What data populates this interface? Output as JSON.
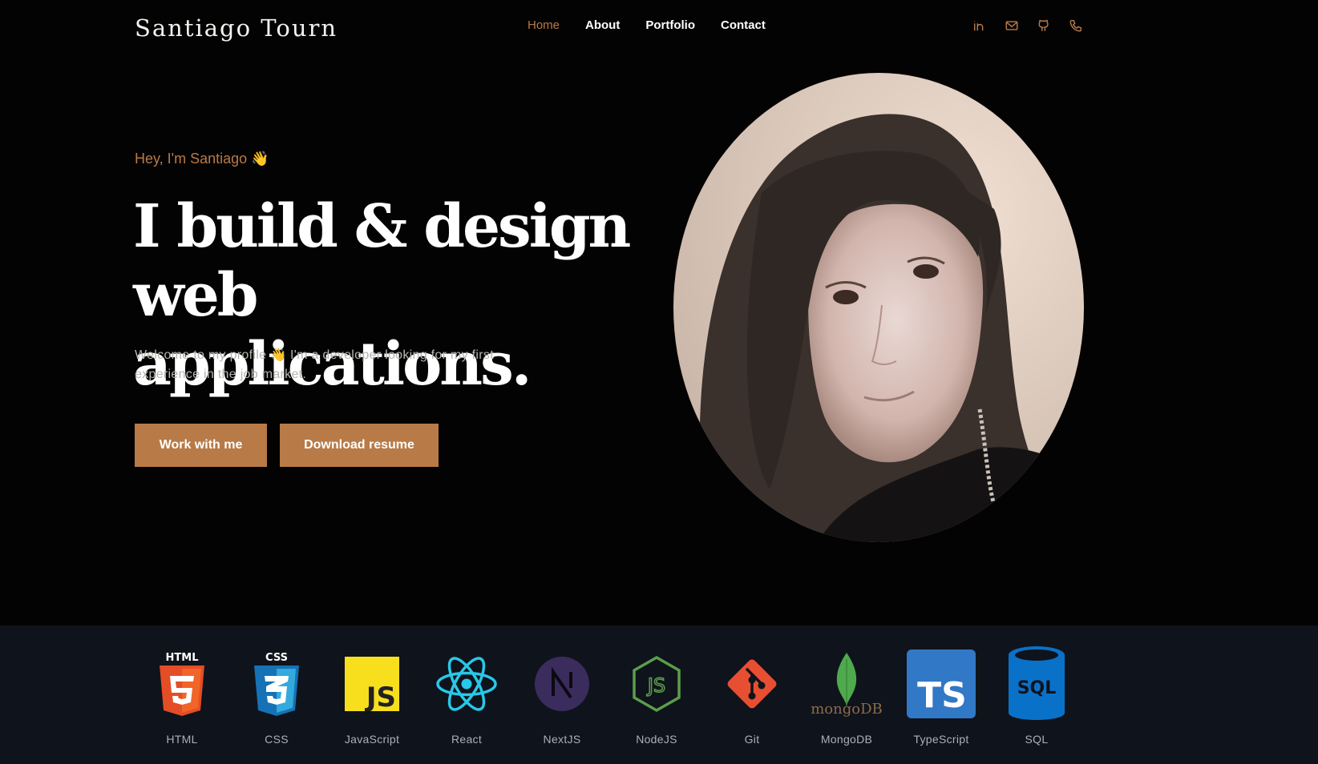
{
  "header": {
    "logo": "Santiago Tourn",
    "nav": [
      {
        "label": "Home",
        "active": true
      },
      {
        "label": "About"
      },
      {
        "label": "Portfolio"
      },
      {
        "label": "Contact"
      }
    ],
    "socials": [
      "linkedin-icon",
      "mail-icon",
      "github-icon",
      "phone-icon"
    ]
  },
  "hero": {
    "greeting": "Hey, I'm Santiago 👋",
    "headline_line1": "I build & design",
    "headline_line2": "web applications.",
    "intro": "Welcome to my profile 👋 I'm a developer looking for my first experience in the job market.",
    "primary_button": "Work with me",
    "secondary_button": "Download resume"
  },
  "skills": [
    {
      "label": "HTML",
      "icon": "html5-icon"
    },
    {
      "label": "CSS",
      "icon": "css3-icon"
    },
    {
      "label": "JavaScript",
      "icon": "javascript-icon"
    },
    {
      "label": "React",
      "icon": "react-icon"
    },
    {
      "label": "NextJS",
      "icon": "nextjs-icon"
    },
    {
      "label": "NodeJS",
      "icon": "nodejs-icon"
    },
    {
      "label": "Git",
      "icon": "git-icon"
    },
    {
      "label": "MongoDB",
      "icon": "mongodb-icon",
      "wordmark": "mongoDB"
    },
    {
      "label": "TypeScript",
      "icon": "typescript-icon"
    },
    {
      "label": "SQL",
      "icon": "sql-icon"
    }
  ],
  "colors": {
    "accent": "#b87a46",
    "background": "#040303",
    "skills_band": "#0f131b"
  }
}
